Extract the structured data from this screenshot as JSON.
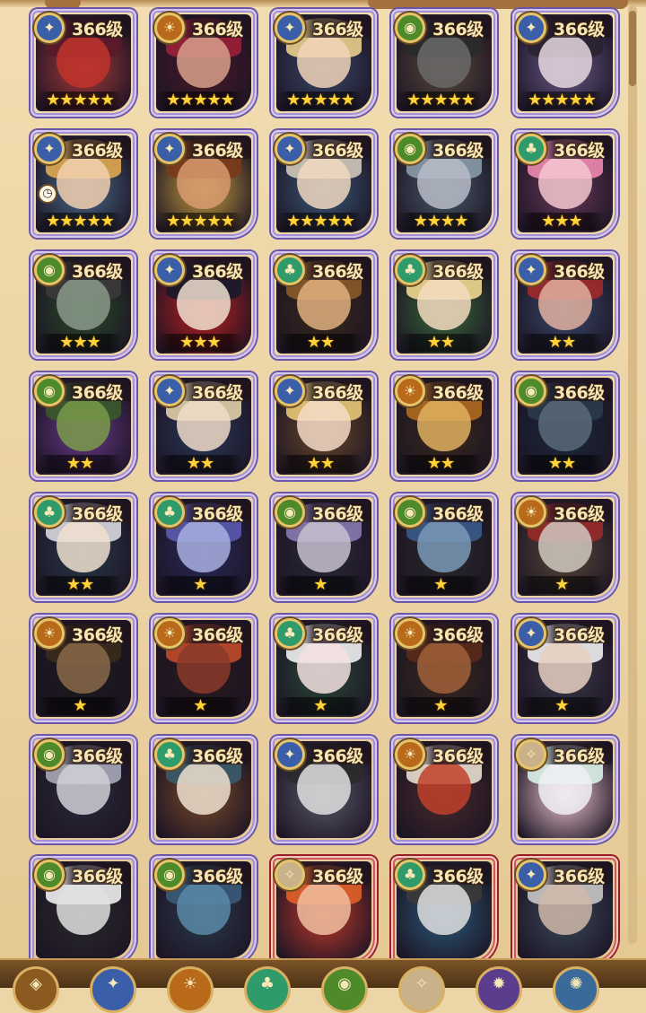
{
  "screen": "hero-roster",
  "level_suffix": "级",
  "factions": {
    "lightbearer": {
      "glyph": "✦",
      "bg": "#3a5fa8"
    },
    "mauler": {
      "glyph": "☀",
      "bg": "#b86a1a"
    },
    "wilder": {
      "glyph": "♣",
      "bg": "#2f9a6a"
    },
    "graveborn": {
      "glyph": "◉",
      "bg": "#4f8a2a"
    },
    "celestial": {
      "glyph": "✧",
      "bg": "#c9b28a"
    },
    "hypogean": {
      "glyph": "✹",
      "bg": "#5a3d8c"
    }
  },
  "heroes": [
    {
      "level": "366级",
      "stars": "★★★★★",
      "faction": "lightbearer",
      "frame": "purple",
      "skin": [
        "#c0342c",
        "#5a1a2a",
        "#a83a3a"
      ]
    },
    {
      "level": "366级",
      "stars": "★★★★★",
      "faction": "mauler",
      "frame": "purple",
      "skin": [
        "#d7a08a",
        "#9a1f3a",
        "#4a1a2a"
      ]
    },
    {
      "level": "366级",
      "stars": "★★★★★",
      "faction": "lightbearer",
      "frame": "purple",
      "skin": [
        "#f1d3b8",
        "#e8cf8a",
        "#3a4a6a"
      ]
    },
    {
      "level": "366级",
      "stars": "★★★★★",
      "faction": "graveborn",
      "frame": "purple",
      "skin": [
        "#6a6a6a",
        "#2a2a2a",
        "#5a4a3a"
      ]
    },
    {
      "level": "366级",
      "stars": "★★★★★",
      "faction": "lightbearer",
      "frame": "purple",
      "skin": [
        "#e8d8e0",
        "#2a2230",
        "#6a5a8a"
      ]
    },
    {
      "level": "366级",
      "stars": "★★★★★",
      "faction": "lightbearer",
      "frame": "purple",
      "skin": [
        "#f2d0b0",
        "#e0a850",
        "#4a6a8a"
      ],
      "clock": true
    },
    {
      "level": "366级",
      "stars": "★★★★★",
      "faction": "lightbearer",
      "frame": "purple",
      "skin": [
        "#d79a70",
        "#7a3a1a",
        "#c8a040"
      ]
    },
    {
      "level": "366级",
      "stars": "★★★★★",
      "faction": "lightbearer",
      "frame": "purple",
      "skin": [
        "#f0d8c0",
        "#d0c8b8",
        "#3a5a7a"
      ]
    },
    {
      "level": "366级",
      "stars": "★★★★",
      "faction": "graveborn",
      "frame": "purple",
      "skin": [
        "#b8bcc8",
        "#8a9aa8",
        "#4a5a6a"
      ]
    },
    {
      "level": "366级",
      "stars": "★★★",
      "faction": "wilder",
      "frame": "purple",
      "skin": [
        "#f4c8d0",
        "#f08ab0",
        "#6a3a5a"
      ]
    },
    {
      "level": "366级",
      "stars": "★★★",
      "faction": "graveborn",
      "frame": "purple",
      "skin": [
        "#8a9a8a",
        "#3a3a3a",
        "#2a4a2a"
      ]
    },
    {
      "level": "366级",
      "stars": "★★★",
      "faction": "lightbearer",
      "frame": "purple",
      "skin": [
        "#f0e0d0",
        "#1a1a2a",
        "#c02020"
      ]
    },
    {
      "level": "366级",
      "stars": "★★",
      "faction": "wilder",
      "frame": "purple",
      "skin": [
        "#e0b080",
        "#8a5a2a",
        "#3a2a1a"
      ]
    },
    {
      "level": "366级",
      "stars": "★★",
      "faction": "wilder",
      "frame": "purple",
      "skin": [
        "#f4dcc0",
        "#f0d890",
        "#3a6a3a"
      ]
    },
    {
      "level": "366级",
      "stars": "★★",
      "faction": "lightbearer",
      "frame": "purple",
      "skin": [
        "#e0b0a0",
        "#a02a2a",
        "#3a4a6a"
      ]
    },
    {
      "level": "366级",
      "stars": "★★",
      "faction": "graveborn",
      "frame": "purple",
      "skin": [
        "#7a9a4a",
        "#3a5a2a",
        "#6a3a8a"
      ]
    },
    {
      "level": "366级",
      "stars": "★★",
      "faction": "lightbearer",
      "frame": "purple",
      "skin": [
        "#f0dcc8",
        "#e0d0a8",
        "#2a3a5a"
      ]
    },
    {
      "level": "366级",
      "stars": "★★",
      "faction": "lightbearer",
      "frame": "purple",
      "skin": [
        "#f4dcc8",
        "#e8c878",
        "#6a4a2a"
      ]
    },
    {
      "level": "366级",
      "stars": "★★",
      "faction": "mauler",
      "frame": "purple",
      "skin": [
        "#e0b060",
        "#b06a20",
        "#3a2a1a"
      ]
    },
    {
      "level": "366级",
      "stars": "★★",
      "faction": "graveborn",
      "frame": "purple",
      "skin": [
        "#5a6a7a",
        "#2a3a4a",
        "#1a2a3a"
      ]
    },
    {
      "level": "366级",
      "stars": "★★",
      "faction": "wilder",
      "frame": "purple",
      "skin": [
        "#f0e0d0",
        "#d8d8e0",
        "#2a3a4a"
      ]
    },
    {
      "level": "366级",
      "stars": "★",
      "faction": "wilder",
      "frame": "purple",
      "skin": [
        "#a8b0e0",
        "#5a5ab0",
        "#2a2a5a"
      ]
    },
    {
      "level": "366级",
      "stars": "★",
      "faction": "graveborn",
      "frame": "purple",
      "skin": [
        "#c8c0d0",
        "#8a7ab0",
        "#2a2a3a"
      ]
    },
    {
      "level": "366级",
      "stars": "★",
      "faction": "graveborn",
      "frame": "purple",
      "skin": [
        "#7a9ab8",
        "#3a5a8a",
        "#2a2a2a"
      ]
    },
    {
      "level": "366级",
      "stars": "★",
      "faction": "mauler",
      "frame": "purple",
      "skin": [
        "#d0c8c0",
        "#9a2a2a",
        "#5a4a3a"
      ]
    },
    {
      "level": "366级",
      "stars": "★",
      "faction": "mauler",
      "frame": "purple",
      "skin": [
        "#8a6a4a",
        "#3a2a1a",
        "#1a1a1a"
      ]
    },
    {
      "level": "366级",
      "stars": "★",
      "faction": "mauler",
      "frame": "purple",
      "skin": [
        "#8a3a2a",
        "#c04a2a",
        "#2a1a1a"
      ]
    },
    {
      "level": "366级",
      "stars": "★",
      "faction": "wilder",
      "frame": "purple",
      "skin": [
        "#f4e0e0",
        "#f0f0f0",
        "#2a4a3a"
      ]
    },
    {
      "level": "366级",
      "stars": "★",
      "faction": "mauler",
      "frame": "purple",
      "skin": [
        "#a0603a",
        "#5a2a1a",
        "#3a2a1a"
      ]
    },
    {
      "level": "366级",
      "stars": "★",
      "faction": "lightbearer",
      "frame": "purple",
      "skin": [
        "#e8d0c0",
        "#f0f0f0",
        "#3a3a4a"
      ]
    },
    {
      "level": "366级",
      "stars": "",
      "faction": "graveborn",
      "frame": "purple",
      "skin": [
        "#d0d0d8",
        "#a8a8b8",
        "#2a2a3a"
      ]
    },
    {
      "level": "366级",
      "stars": "",
      "faction": "wilder",
      "frame": "purple",
      "skin": [
        "#f0e0d0",
        "#3a5a6a",
        "#7a4a2a"
      ]
    },
    {
      "level": "366级",
      "stars": "",
      "faction": "lightbearer",
      "frame": "purple",
      "skin": [
        "#e0e0e0",
        "#2a2a2a",
        "#5a5a6a"
      ]
    },
    {
      "level": "366级",
      "stars": "",
      "faction": "mauler",
      "frame": "purple",
      "skin": [
        "#c0402a",
        "#e8e0d0",
        "#4a2a2a"
      ]
    },
    {
      "level": "366级",
      "stars": "",
      "faction": "celestial",
      "frame": "purple",
      "skin": [
        "#f0f0f4",
        "#d8f0e8",
        "#f0c8d0"
      ]
    },
    {
      "level": "366级",
      "stars": "",
      "faction": "graveborn",
      "frame": "purple",
      "skin": [
        "#e0e0e0",
        "#f0f0f0",
        "#2a2a2a"
      ]
    },
    {
      "level": "366级",
      "stars": "",
      "faction": "graveborn",
      "frame": "purple",
      "skin": [
        "#5a8aa8",
        "#3a5a7a",
        "#2a3a4a"
      ]
    },
    {
      "level": "366级",
      "stars": "",
      "faction": "celestial",
      "frame": "red",
      "skin": [
        "#f0c0a0",
        "#e0602a",
        "#c03a2a"
      ]
    },
    {
      "level": "366级",
      "stars": "",
      "faction": "wilder",
      "frame": "red",
      "skin": [
        "#e0e0e0",
        "#3a3a3a",
        "#2a5a7a"
      ]
    },
    {
      "level": "366级",
      "stars": "",
      "faction": "lightbearer",
      "frame": "red",
      "skin": [
        "#d0b8a8",
        "#c8c8c8",
        "#3a4a5a"
      ]
    }
  ],
  "filters": [
    {
      "name": "all",
      "glyph": "◈",
      "bg": "#8a5a20"
    },
    {
      "name": "lightbearer",
      "glyph": "✦",
      "bg": "#3a5fa8"
    },
    {
      "name": "mauler",
      "glyph": "☀",
      "bg": "#b86a1a"
    },
    {
      "name": "wilder",
      "glyph": "♣",
      "bg": "#2f9a6a"
    },
    {
      "name": "graveborn",
      "glyph": "◉",
      "bg": "#4f8a2a"
    },
    {
      "name": "celestial",
      "glyph": "✧",
      "bg": "#c9b28a"
    },
    {
      "name": "hypogean",
      "glyph": "✹",
      "bg": "#5a3d8c"
    },
    {
      "name": "dimensional",
      "glyph": "✺",
      "bg": "#3a6a9a"
    }
  ]
}
